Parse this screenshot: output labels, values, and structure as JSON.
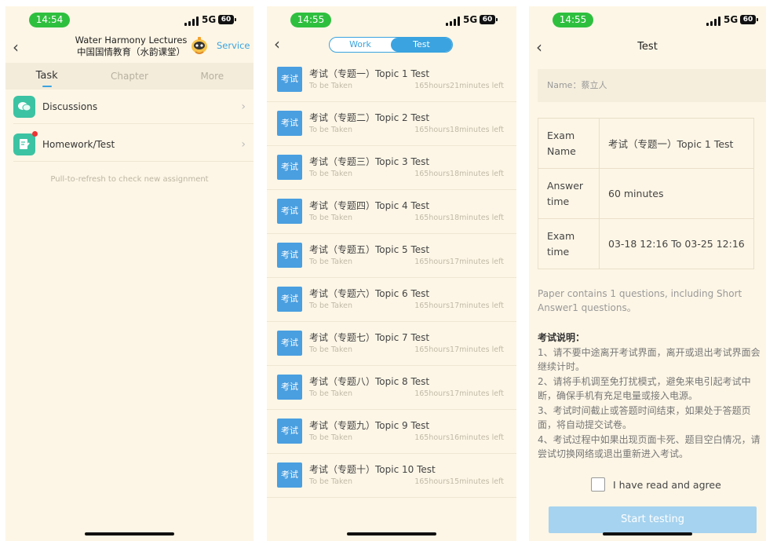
{
  "phone1": {
    "status": {
      "time": "14:54",
      "network": "5G",
      "battery": "60"
    },
    "header": {
      "title_en": "Water Harmony Lectures",
      "title_cn": "中国国情教育（水韵课堂）",
      "service": "Service"
    },
    "tabs": [
      "Task",
      "Chapter",
      "More"
    ],
    "rows": [
      {
        "label": "Discussions",
        "icon": "chat-bubble-icon"
      },
      {
        "label": "Homework/Test",
        "icon": "edit-document-icon"
      }
    ],
    "hint": "Pull-to-refresh to check new assignment"
  },
  "phone2": {
    "status": {
      "time": "14:55",
      "network": "5G",
      "battery": "60"
    },
    "segment": {
      "work": "Work",
      "test": "Test"
    },
    "items": [
      {
        "badge": "考试",
        "title": "考试（专题一）Topic 1 Test",
        "status": "To be Taken",
        "remaining": "165hours21minutes left"
      },
      {
        "badge": "考试",
        "title": "考试（专题二）Topic 2 Test",
        "status": "To be Taken",
        "remaining": "165hours18minutes left"
      },
      {
        "badge": "考试",
        "title": "考试（专题三）Topic 3 Test",
        "status": "To be Taken",
        "remaining": "165hours18minutes left"
      },
      {
        "badge": "考试",
        "title": "考试（专题四）Topic 4 Test",
        "status": "To be Taken",
        "remaining": "165hours18minutes left"
      },
      {
        "badge": "考试",
        "title": "考试（专题五）Topic 5 Test",
        "status": "To be Taken",
        "remaining": "165hours17minutes left"
      },
      {
        "badge": "考试",
        "title": "考试（专题六）Topic 6 Test",
        "status": "To be Taken",
        "remaining": "165hours17minutes left"
      },
      {
        "badge": "考试",
        "title": "考试（专题七）Topic 7 Test",
        "status": "To be Taken",
        "remaining": "165hours17minutes left"
      },
      {
        "badge": "考试",
        "title": "考试（专题八）Topic 8 Test",
        "status": "To be Taken",
        "remaining": "165hours17minutes left"
      },
      {
        "badge": "考试",
        "title": "考试（专题九）Topic 9 Test",
        "status": "To be Taken",
        "remaining": "165hours16minutes left"
      },
      {
        "badge": "考试",
        "title": "考试（专题十）Topic 10 Test",
        "status": "To be Taken",
        "remaining": "165hours15minutes left"
      }
    ]
  },
  "phone3": {
    "status": {
      "time": "14:55",
      "network": "5G",
      "battery": "60"
    },
    "title": "Test",
    "name": "Name：蔡立人",
    "table": {
      "exam_name_label": "Exam Name",
      "exam_name": "考试（专题一）Topic 1 Test",
      "answer_time_label": "Answer time",
      "answer_time": "60 minutes",
      "exam_time_label": "Exam time",
      "exam_time": "03-18 12:16 To 03-25 12:16"
    },
    "paper_info": "Paper contains 1 questions, including Short Answer1 questions。",
    "rules_heading": "考试说明：",
    "rules": [
      "1、请不要中途离开考试界面，离开或退出考试界面会继续计时。",
      "2、请将手机调至免打扰模式，避免来电引起考试中断，确保手机有充足电量或接入电源。",
      "3、考试时间截止或答题时间结束，如果处于答题页面，将自动提交试卷。",
      "4、考试过程中如果出现页面卡死、题目空白情况，请尝试切换网络或退出重新进入考试。"
    ],
    "agree": "I have read and agree",
    "start": "Start testing"
  },
  "colors": {
    "accent": "#3aa3e0",
    "background": "#fdf6e6",
    "icon_green": "#3cc3a3",
    "status_green": "#2fbf3f",
    "badge_blue": "#4a9fe0",
    "start_button": "#a6d3ef"
  }
}
